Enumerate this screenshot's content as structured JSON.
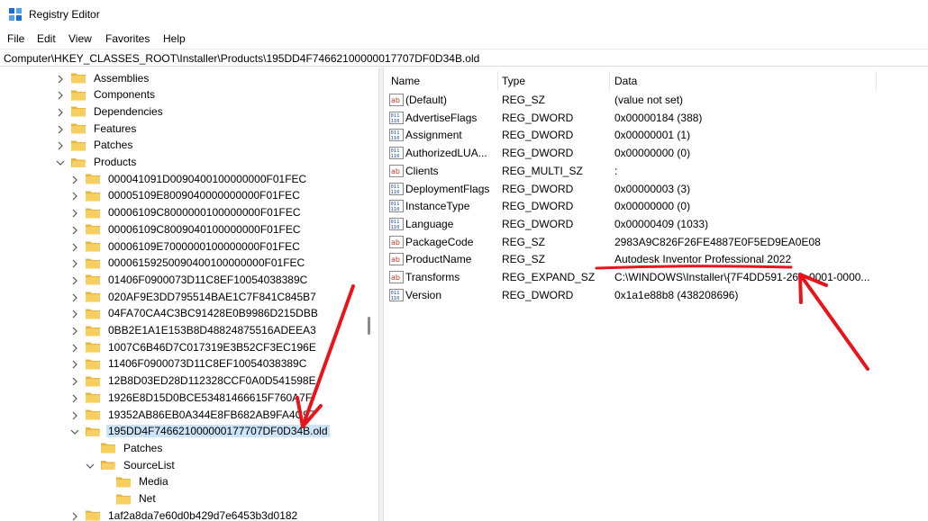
{
  "window": {
    "title": "Registry Editor"
  },
  "menu": [
    "File",
    "Edit",
    "View",
    "Favorites",
    "Help"
  ],
  "address_path": "Computer\\HKEY_CLASSES_ROOT\\Installer\\Products\\195DD4F74662100000017707DF0D34B.old",
  "tree": [
    {
      "label": "Assemblies",
      "state": "collapsed"
    },
    {
      "label": "Components",
      "state": "collapsed"
    },
    {
      "label": "Dependencies",
      "state": "collapsed"
    },
    {
      "label": "Features",
      "state": "collapsed"
    },
    {
      "label": "Patches",
      "state": "collapsed"
    },
    {
      "label": "Products",
      "state": "expanded"
    },
    {
      "label": "000041091D0090400100000000F01FEC",
      "state": "collapsed"
    },
    {
      "label": "00005109E8009040000000000F01FEC",
      "state": "collapsed"
    },
    {
      "label": "00006109C8000000100000000F01FEC",
      "state": "collapsed"
    },
    {
      "label": "00006109C8009040100000000F01FEC",
      "state": "collapsed"
    },
    {
      "label": "00006109E7000000100000000F01FEC",
      "state": "collapsed"
    },
    {
      "label": "00006159250090400100000000F01FEC",
      "state": "collapsed"
    },
    {
      "label": "01406F0900073D11C8EF10054038389C",
      "state": "collapsed"
    },
    {
      "label": "020AF9E3DD795514BAE1C7F841C845B7",
      "state": "collapsed"
    },
    {
      "label": "04FA70CA4C3BC91428E0B9986D215DBB",
      "state": "collapsed"
    },
    {
      "label": "0BB2E1A1E153B8D48824875516ADEEA3",
      "state": "collapsed"
    },
    {
      "label": "1007C6B46D7C017319E3B52CF3EC196E",
      "state": "collapsed"
    },
    {
      "label": "11406F0900073D11C8EF10054038389C",
      "state": "collapsed"
    },
    {
      "label": "12B8D03ED28D112328CCF0A0D541598E",
      "state": "collapsed"
    },
    {
      "label": "1926E8D15D0BCE53481466615F760A7F",
      "state": "collapsed"
    },
    {
      "label": "19352AB86EB0A344E8FB682AB9FA4C97",
      "state": "collapsed"
    },
    {
      "label": "195DD4F746621000000177707DF0D34B.old",
      "state": "expanded",
      "selected": true
    },
    {
      "label": "Patches",
      "state": "leaf"
    },
    {
      "label": "SourceList",
      "state": "expanded"
    },
    {
      "label": "Media",
      "state": "leaf"
    },
    {
      "label": "Net",
      "state": "leaf"
    },
    {
      "label": "1af2a8da7e60d0b429d7e6453b3d0182",
      "state": "collapsed"
    }
  ],
  "columns": {
    "name": "Name",
    "type": "Type",
    "data": "Data"
  },
  "values": [
    {
      "icon": "string-value-icon",
      "name": "(Default)",
      "type": "REG_SZ",
      "data": "(value not set)"
    },
    {
      "icon": "binary-value-icon",
      "name": "AdvertiseFlags",
      "type": "REG_DWORD",
      "data": "0x00000184 (388)"
    },
    {
      "icon": "binary-value-icon",
      "name": "Assignment",
      "type": "REG_DWORD",
      "data": "0x00000001 (1)"
    },
    {
      "icon": "binary-value-icon",
      "name": "AuthorizedLUA...",
      "type": "REG_DWORD",
      "data": "0x00000000 (0)"
    },
    {
      "icon": "string-value-icon",
      "name": "Clients",
      "type": "REG_MULTI_SZ",
      "data": ":"
    },
    {
      "icon": "binary-value-icon",
      "name": "DeploymentFlags",
      "type": "REG_DWORD",
      "data": "0x00000003 (3)"
    },
    {
      "icon": "binary-value-icon",
      "name": "InstanceType",
      "type": "REG_DWORD",
      "data": "0x00000000 (0)"
    },
    {
      "icon": "binary-value-icon",
      "name": "Language",
      "type": "REG_DWORD",
      "data": "0x00000409 (1033)"
    },
    {
      "icon": "string-value-icon",
      "name": "PackageCode",
      "type": "REG_SZ",
      "data": "2983A9C826F26FE4887E0F5ED9EA0E08"
    },
    {
      "icon": "string-value-icon",
      "name": "ProductName",
      "type": "REG_SZ",
      "data": "Autodesk Inventor Professional 2022"
    },
    {
      "icon": "string-value-icon",
      "name": "Transforms",
      "type": "REG_EXPAND_SZ",
      "data": "C:\\WINDOWS\\Installer\\{7F4DD591-26··-0001-0000..."
    },
    {
      "icon": "binary-value-icon",
      "name": "Version",
      "type": "REG_DWORD",
      "data": "0x1a1e88b8 (438208696)"
    }
  ],
  "colors": {
    "annotation": "#e8141c",
    "selection": "#cce4f7",
    "folder": "#f5c342"
  }
}
